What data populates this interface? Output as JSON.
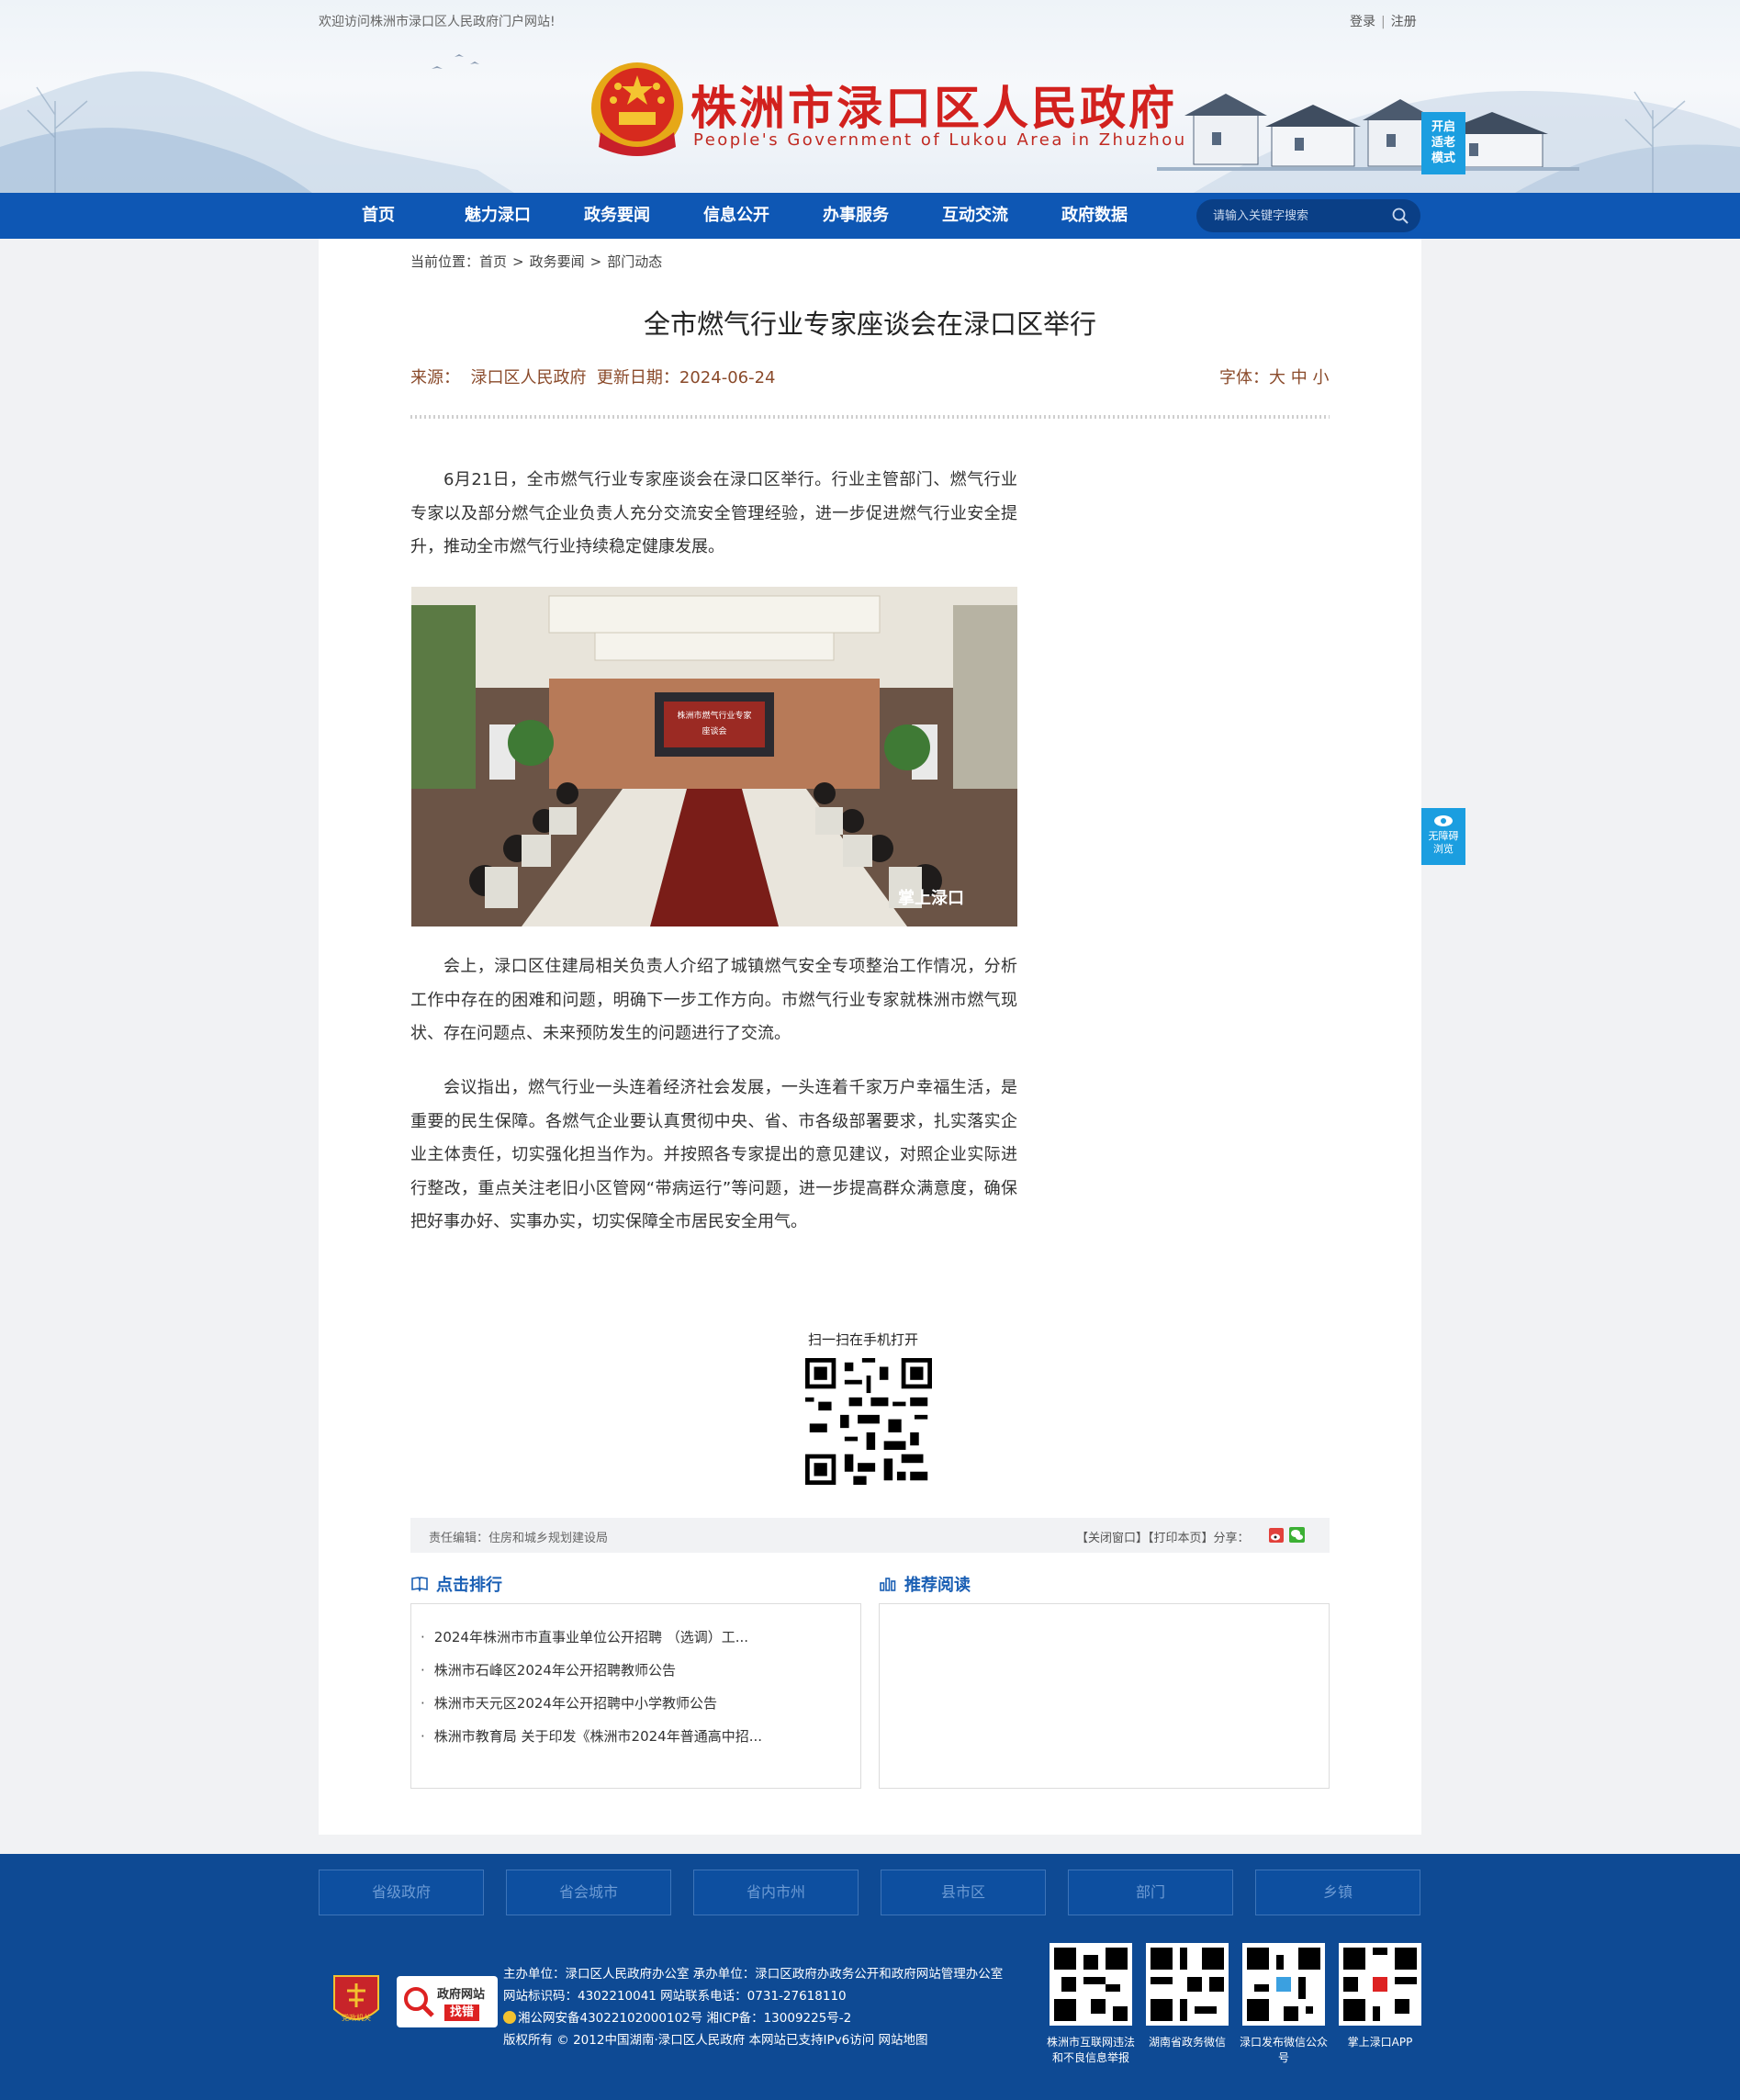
{
  "header": {
    "welcome": "欢迎访问株洲市渌口区人民政府门户网站!",
    "login": "登录",
    "register": "注册",
    "site_title": "株洲市渌口区人民政府",
    "site_subtitle": "People's Government of Lukou Area in Zhuzhou",
    "elder_mode": [
      "开启",
      "适老",
      "模式"
    ]
  },
  "nav": {
    "items": [
      "首页",
      "魅力渌口",
      "政务要闻",
      "信息公开",
      "办事服务",
      "互动交流",
      "政府数据"
    ],
    "search_placeholder": "请输入关键字搜索"
  },
  "breadcrumb": {
    "label": "当前位置：",
    "items": [
      "首页",
      "政务要闻",
      "部门动态"
    ]
  },
  "article": {
    "title": "全市燃气行业专家座谈会在渌口区举行",
    "meta": "来源：  渌口区人民政府  更新日期：2024-06-24",
    "font_label": "字体：",
    "font_sizes": [
      "大",
      "中",
      "小"
    ],
    "paragraphs": [
      "6月21日，全市燃气行业专家座谈会在渌口区举行。行业主管部门、燃气行业专家以及部分燃气企业负责人充分交流安全管理经验，进一步促进燃气行业安全提升，推动全市燃气行业持续稳定健康发展。",
      "会上，渌口区住建局相关负责人介绍了城镇燃气安全专项整治工作情况，分析工作中存在的困难和问题，明确下一步工作方向。市燃气行业专家就株洲市燃气现状、存在问题点、未来预防发生的问题进行了交流。",
      "会议指出，燃气行业一头连着经济社会发展，一头连着千家万户幸福生活，是重要的民生保障。各燃气企业要认真贯彻中央、省、市各级部署要求，扎实落实企业主体责任，切实强化担当作为。并按照各专家提出的意见建议，对照企业实际进行整改，重点关注老旧小区管网“带病运行”等问题，进一步提高群众满意度，确保把好事办好、实事办实，切实保障全市居民安全用气。"
    ],
    "photo_screen_text": [
      "株洲市燃气行业专家",
      "座谈会"
    ],
    "photo_watermark": "掌上渌口",
    "qr_label": "扫一扫在手机打开",
    "editor": "责任编辑：住房和城乡规划建设局",
    "close_window": "【关闭窗口】",
    "print_page": "【打印本页】",
    "share_label": "分享："
  },
  "ranking": {
    "title": "点击排行",
    "items": [
      "2024年株洲市市直事业单位公开招聘 （选调）工...",
      "株洲市石峰区2024年公开招聘教师公告",
      "株洲市天元区2024年公开招聘中小学教师公告",
      "株洲市教育局 关于印发《株洲市2024年普通高中招..."
    ]
  },
  "recommend": {
    "title": "推荐阅读",
    "items": []
  },
  "side": {
    "accessibility": [
      "无障碍",
      "浏览"
    ]
  },
  "footer": {
    "links": [
      "省级政府",
      "省会城市",
      "省内市州",
      "县市区",
      "部门",
      "乡镇"
    ],
    "party_badge": "党政机关",
    "error_badge": [
      "政府网站",
      "找错"
    ],
    "info": [
      "主办单位：渌口区人民政府办公室 承办单位：渌口区政府办政务公开和政府网站管理办公室",
      "网站标识码：4302210041 网站联系电话：0731-27618110",
      "湘公网安备43022102000102号 湘ICP备：13009225号-2",
      "版权所有 © 2012中国湖南·渌口区人民政府 本网站已支持IPv6访问 网站地图"
    ],
    "qr_labels": [
      "株洲市互联网违法和不良信息举报",
      "湖南省政务微信",
      "渌口发布微信公众号",
      "掌上渌口APP"
    ]
  },
  "colors": {
    "nav_blue": "#0e57b4",
    "footer_blue": "#0e4a94",
    "title_red": "#d2211e",
    "accent_blue": "#1b9ee0"
  }
}
